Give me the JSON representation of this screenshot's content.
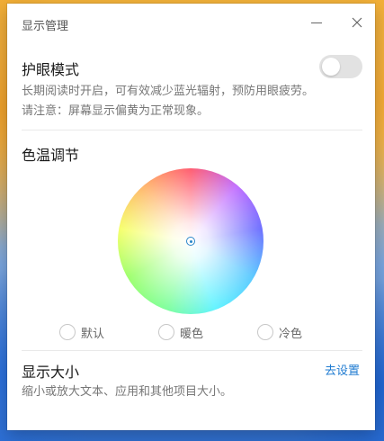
{
  "window": {
    "title": "显示管理"
  },
  "eye_care": {
    "title": "护眼模式",
    "enabled": false,
    "desc_line1": "长期阅读时开启，可有效减少蓝光辐射，预防用眼疲劳。",
    "desc_line2": "请注意：屏幕显示偏黄为正常现象。"
  },
  "color_temp": {
    "title": "色温调节",
    "options": [
      {
        "label": "默认",
        "selected": false
      },
      {
        "label": "暖色",
        "selected": false
      },
      {
        "label": "冷色",
        "selected": false
      }
    ]
  },
  "display_size": {
    "title": "显示大小",
    "link": "去设置",
    "desc": "缩小或放大文本、应用和其他项目大小。"
  },
  "colors": {
    "link": "#1f7bd1",
    "toggle_off": "#e2e2e2"
  }
}
